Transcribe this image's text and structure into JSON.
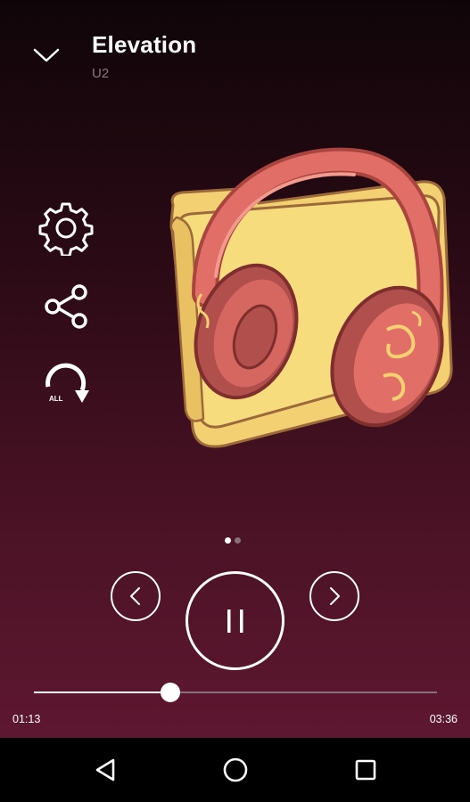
{
  "track": {
    "title": "Elevation",
    "artist": "U2"
  },
  "player": {
    "elapsed": "01:13",
    "total": "03:36",
    "progress_fraction": 0.338,
    "is_playing": true,
    "pager": {
      "pages": 2,
      "active": 1
    }
  },
  "icons": {
    "collapse": "chevron-down-icon",
    "settings": "gear-icon",
    "share": "share-icon",
    "repeat": "repeat-all-icon",
    "repeat_label": "ALL",
    "previous": "chevron-left-icon",
    "play_pause": "pause-icon",
    "next": "chevron-right-icon",
    "artwork": "folder-headphones-icon",
    "nav_back": "back-triangle-icon",
    "nav_home": "home-circle-icon",
    "nav_recents": "recents-square-icon"
  },
  "colors": {
    "background_top": "#0f0508",
    "background_bottom": "#5e1730",
    "accent": "#ffffff",
    "muted_text": "#8a7a80"
  }
}
